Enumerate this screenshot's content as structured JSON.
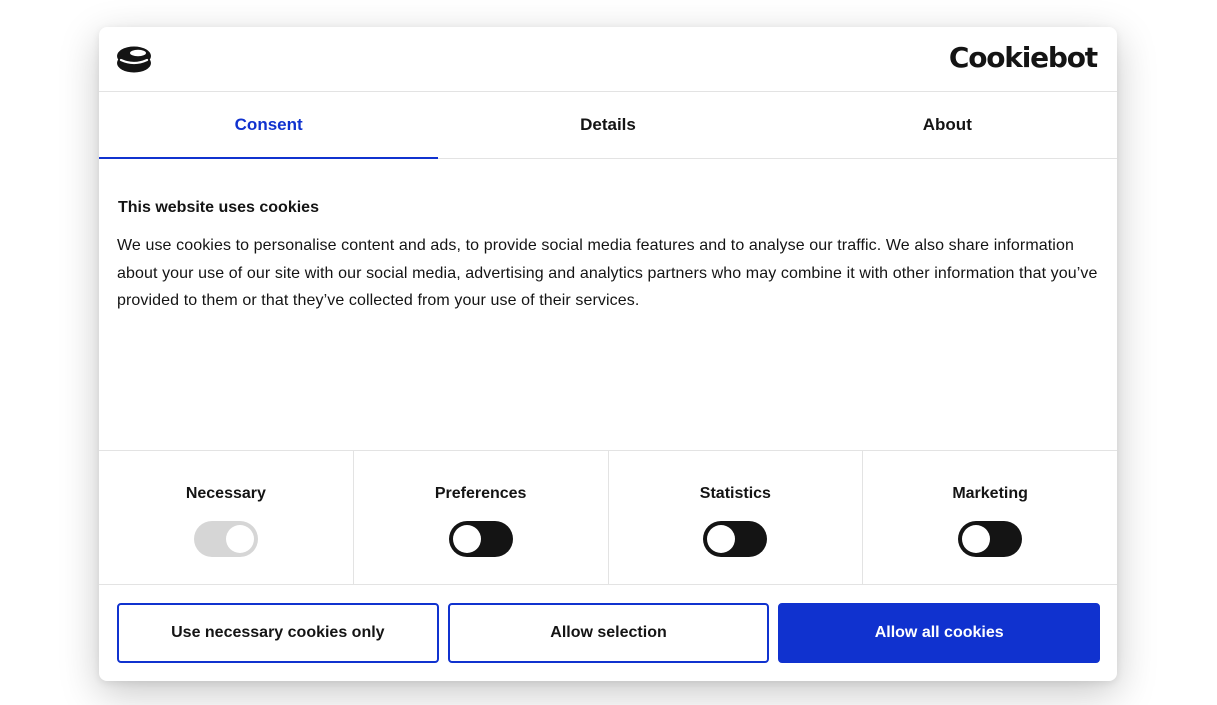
{
  "header": {
    "logo_icon": "cookie-stack-icon",
    "brand": "Cookiebot"
  },
  "tabs": [
    {
      "label": "Consent",
      "active": true
    },
    {
      "label": "Details",
      "active": false
    },
    {
      "label": "About",
      "active": false
    }
  ],
  "content": {
    "heading": "This website uses cookies",
    "text": "We use cookies to personalise content and ads, to provide social media features and to analyse our traffic. We also share information about your use of our site with our social media, advertising and analytics partners who may combine it with other information that you’ve provided to them or that they’ve collected from your use of their services."
  },
  "toggles": [
    {
      "label": "Necessary",
      "checked": true,
      "disabled": true
    },
    {
      "label": "Preferences",
      "checked": false,
      "disabled": false
    },
    {
      "label": "Statistics",
      "checked": false,
      "disabled": false
    },
    {
      "label": "Marketing",
      "checked": false,
      "disabled": false
    }
  ],
  "buttons": {
    "necessary_only": "Use necessary cookies only",
    "allow_selection": "Allow selection",
    "allow_all": "Allow all cookies"
  },
  "colors": {
    "accent": "#1032cf",
    "toggle_off": "#141414",
    "toggle_disabled": "#d6d6d6"
  }
}
